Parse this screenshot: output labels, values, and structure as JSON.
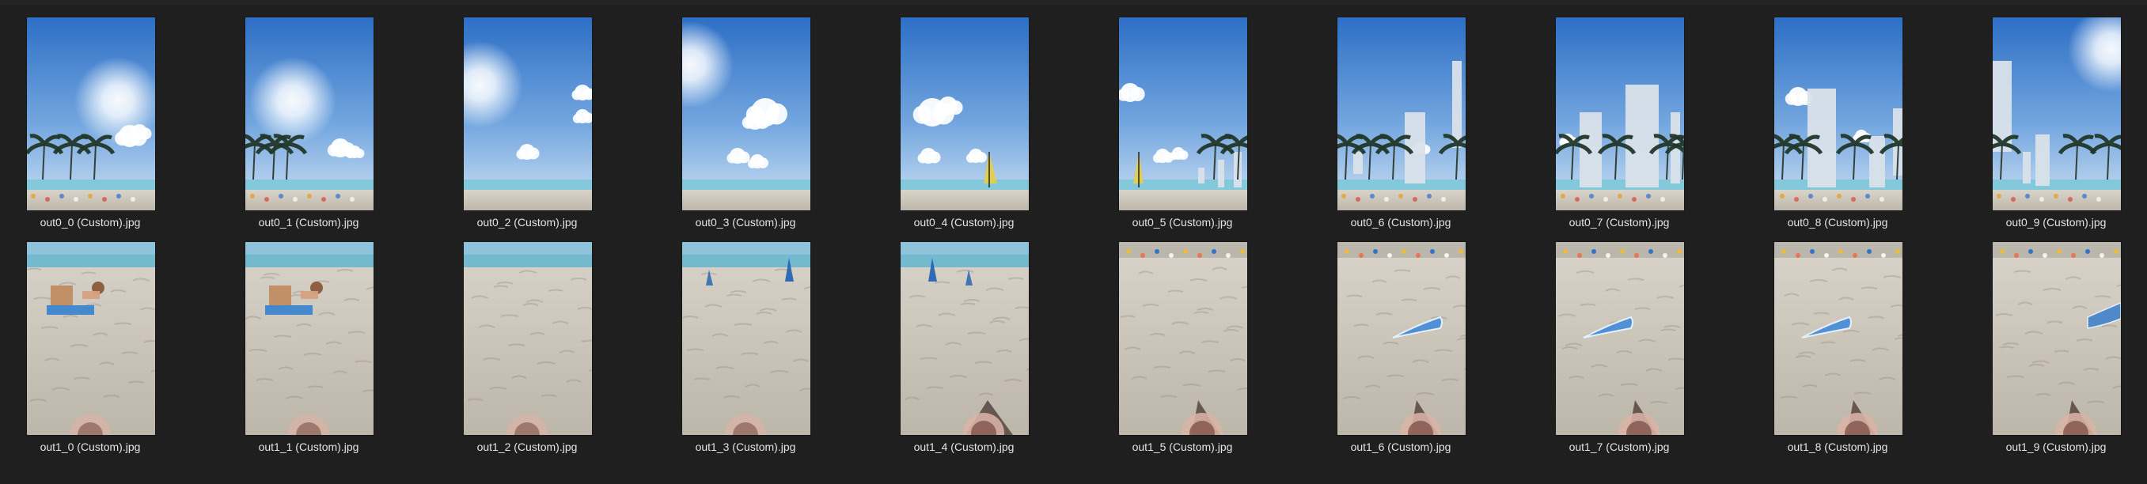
{
  "files": [
    {
      "name": "out0_0 (Custom).jpg",
      "icon": "image-thumbnail-icon"
    },
    {
      "name": "out0_1 (Custom).jpg",
      "icon": "image-thumbnail-icon"
    },
    {
      "name": "out0_2 (Custom).jpg",
      "icon": "image-thumbnail-icon"
    },
    {
      "name": "out0_3 (Custom).jpg",
      "icon": "image-thumbnail-icon"
    },
    {
      "name": "out0_4 (Custom).jpg",
      "icon": "image-thumbnail-icon"
    },
    {
      "name": "out0_5 (Custom).jpg",
      "icon": "image-thumbnail-icon"
    },
    {
      "name": "out0_6 (Custom).jpg",
      "icon": "image-thumbnail-icon"
    },
    {
      "name": "out0_7 (Custom).jpg",
      "icon": "image-thumbnail-icon"
    },
    {
      "name": "out0_8 (Custom).jpg",
      "icon": "image-thumbnail-icon"
    },
    {
      "name": "out0_9 (Custom).jpg",
      "icon": "image-thumbnail-icon"
    },
    {
      "name": "out1_0 (Custom).jpg",
      "icon": "image-thumbnail-icon"
    },
    {
      "name": "out1_1 (Custom).jpg",
      "icon": "image-thumbnail-icon"
    },
    {
      "name": "out1_2 (Custom).jpg",
      "icon": "image-thumbnail-icon"
    },
    {
      "name": "out1_3 (Custom).jpg",
      "icon": "image-thumbnail-icon"
    },
    {
      "name": "out1_4 (Custom).jpg",
      "icon": "image-thumbnail-icon"
    },
    {
      "name": "out1_5 (Custom).jpg",
      "icon": "image-thumbnail-icon"
    },
    {
      "name": "out1_6 (Custom).jpg",
      "icon": "image-thumbnail-icon"
    },
    {
      "name": "out1_7 (Custom).jpg",
      "icon": "image-thumbnail-icon"
    },
    {
      "name": "out1_8 (Custom).jpg",
      "icon": "image-thumbnail-icon"
    },
    {
      "name": "out1_9 (Custom).jpg",
      "icon": "image-thumbnail-icon"
    }
  ]
}
